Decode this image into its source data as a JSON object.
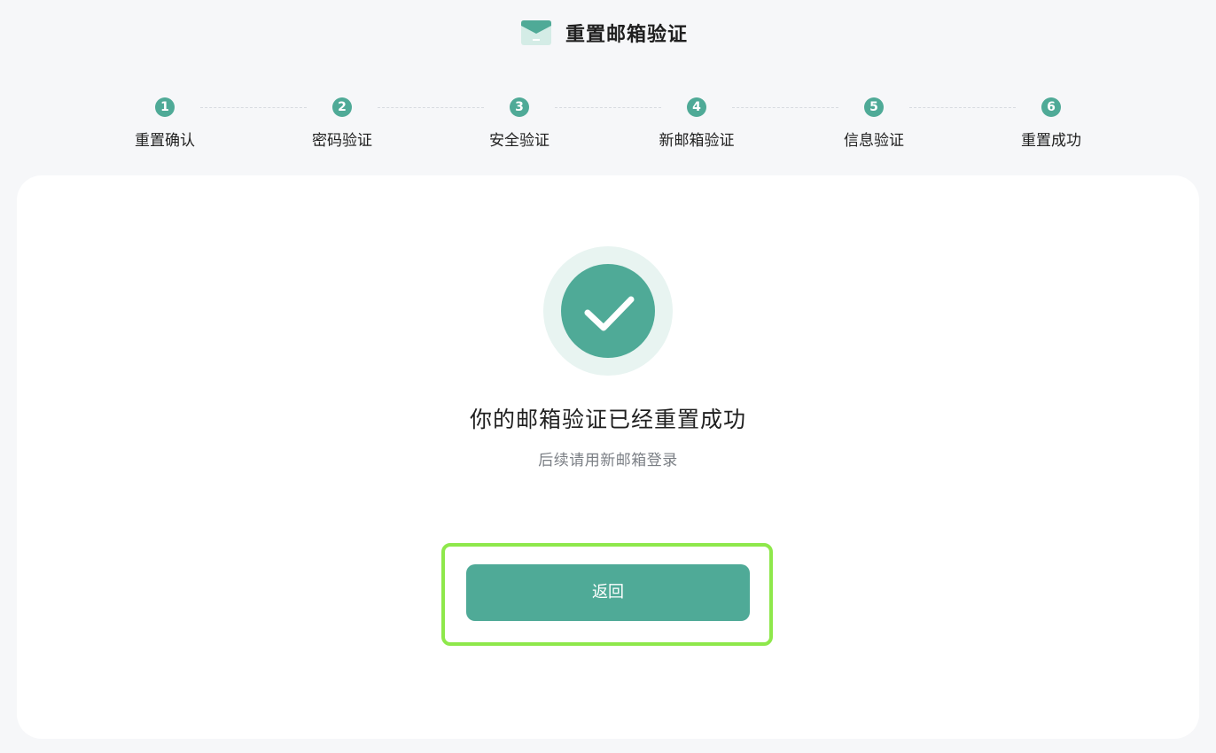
{
  "header": {
    "title": "重置邮箱验证",
    "logo_icon": "envelope-icon"
  },
  "steps": [
    {
      "num": "1",
      "label": "重置确认"
    },
    {
      "num": "2",
      "label": "密码验证"
    },
    {
      "num": "3",
      "label": "安全验证"
    },
    {
      "num": "4",
      "label": "新邮箱验证"
    },
    {
      "num": "5",
      "label": "信息验证"
    },
    {
      "num": "6",
      "label": "重置成功"
    }
  ],
  "result": {
    "icon": "check-circle-icon",
    "title": "你的邮箱验证已经重置成功",
    "subtitle": "后续请用新邮箱登录"
  },
  "actions": {
    "back_label": "返回"
  },
  "colors": {
    "accent": "#4faa97",
    "accent_light": "#e8f4f1",
    "highlight": "#8ee84b"
  }
}
